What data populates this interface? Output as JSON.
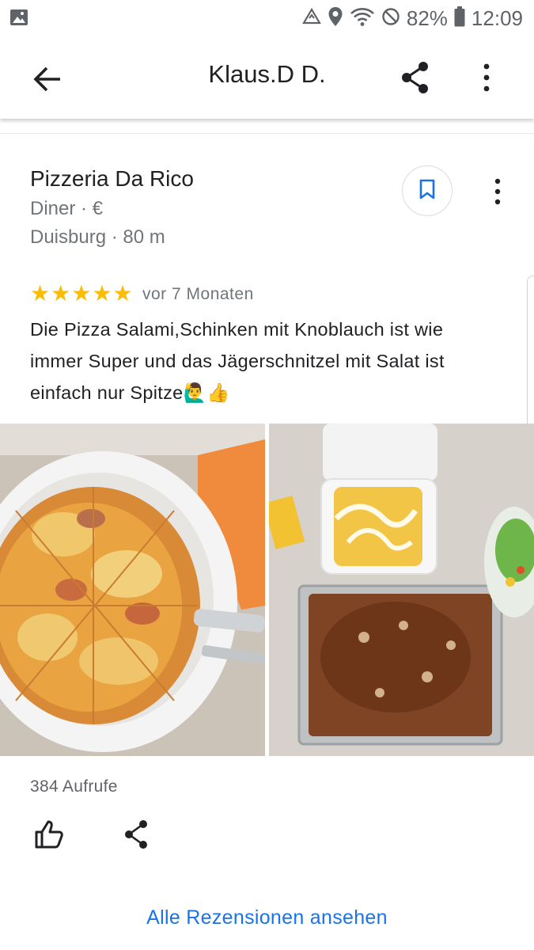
{
  "status_bar": {
    "battery": "82%",
    "time": "12:09",
    "icons": [
      "image-notification-icon",
      "data-saver-icon",
      "location-icon",
      "wifi-icon",
      "do-not-disturb-icon",
      "battery-icon"
    ]
  },
  "app_bar": {
    "title": "Klaus.D D.",
    "icons": [
      "back-arrow-icon",
      "share-icon",
      "more-vert-icon"
    ]
  },
  "place": {
    "name": "Pizzeria Da Rico",
    "category": "Diner · €",
    "location": "Duisburg · 80 m"
  },
  "review": {
    "stars": 5,
    "star_glyph": "★",
    "time": "vor 7 Monaten",
    "lines": [
      "Die Pizza Salami,Schinken mit Knoblauch ist wie",
      "immer Super und das Jägerschnitzel mit Salat ist",
      "einfach nur Spitze🙋‍♂️👍"
    ],
    "photos": [
      "pizza-photo",
      "schnitzel-fries-salad-photo"
    ]
  },
  "footer": {
    "views": "384 Aufrufe",
    "all_reviews_link": "Alle Rezensionen ansehen"
  },
  "colors": {
    "star": "#fbbc04",
    "link": "#1a73e8",
    "secondary_text": "#70757a",
    "save_icon": "#1a73e8"
  }
}
